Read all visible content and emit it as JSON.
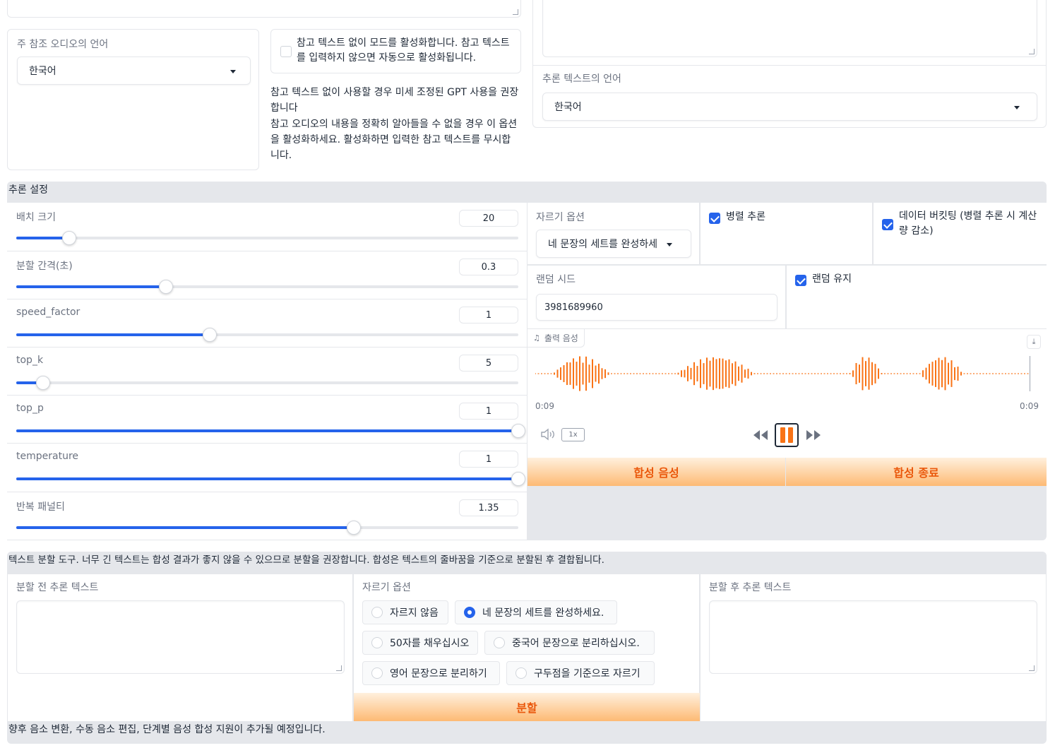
{
  "top": {
    "ref_lang_label": "주 참조 오디오의 언어",
    "ref_lang_value": "한국어",
    "no_ref_text_checkbox": "참고 텍스트 없이 모드를 활성화합니다. 참고 텍스트를 입력하지 않으면 자동으로 활성화됩니다.",
    "no_ref_text_checked": false,
    "note_line1": "참고 텍스트 없이 사용할 경우 미세 조정된 GPT 사용을 권장합니다",
    "note_line2": "참고 오디오의 내용을 정확히 알아들을 수 없을 경우 이 옵션을 활성화하세요. 활성화하면 입력한 참고 텍스트를 무시합니다.",
    "infer_lang_label": "추론 텍스트의 언어",
    "infer_lang_value": "한국어"
  },
  "inference": {
    "header": "추론 설정",
    "sliders": [
      {
        "label": "배치 크기",
        "value": "20",
        "fraction": 0.106
      },
      {
        "label": "분할 간격(초)",
        "value": "0.3",
        "fraction": 0.298
      },
      {
        "label": "speed_factor",
        "value": "1",
        "fraction": 0.385
      },
      {
        "label": "top_k",
        "value": "5",
        "fraction": 0.053
      },
      {
        "label": "top_p",
        "value": "1",
        "fraction": 1.0
      },
      {
        "label": "temperature",
        "value": "1",
        "fraction": 1.0
      },
      {
        "label": "반복 패널티",
        "value": "1.35",
        "fraction": 0.672
      }
    ],
    "cut_label": "자르기 옵션",
    "cut_value": "네 문장의 세트를 완성하세",
    "parallel_label": "병렬 추론",
    "parallel_checked": true,
    "bucket_label": "데이터 버킷팅 (병렬 추론 시 계산량 감소)",
    "bucket_checked": true,
    "seed_label": "랜덤 시드",
    "seed_value": "3981689960",
    "keep_random_label": "랜덤 유지",
    "keep_random_checked": true,
    "audio_label": "출력 음성",
    "time_start": "0:09",
    "time_end": "0:09",
    "speed_btn": "1x",
    "synth_btn": "합성 음성",
    "stop_btn": "합성 종료"
  },
  "splitter": {
    "header": "텍스트 분할 도구. 너무 긴 텍스트는 합성 결과가 좋지 않을 수 있으므로 분할을 권장합니다. 합성은 텍스트의 줄바꿈을 기준으로 분할된 후 결합됩니다.",
    "before_label": "분할 전 추론 텍스트",
    "cut_label": "자르기 옵션",
    "options": [
      "자르지 않음",
      "네 문장의 세트를 완성하세요.",
      "50자를 채우십시오",
      "중국어 문장으로 분리하십시오.",
      "영어 문장으로 분리하기",
      "구두점을 기준으로 자르기"
    ],
    "selected_option": "네 문장의 세트를 완성하세요.",
    "split_btn": "분할",
    "after_label": "분할 후 추론 텍스트"
  },
  "footer": "향후 음소 변환, 수동 음소 편집, 단계별 음성 합성 지원이 추가될 예정입니다.",
  "colors": {
    "accent_blue": "#2563eb",
    "accent_orange": "#f97316",
    "panel_gray": "#e5e7eb"
  }
}
